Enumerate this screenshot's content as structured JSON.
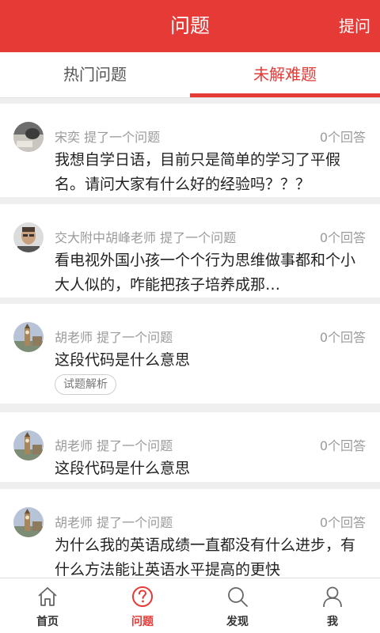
{
  "header": {
    "title": "问题",
    "ask_label": "提问"
  },
  "tabs": [
    {
      "label": "热门问题",
      "active": false
    },
    {
      "label": "未解难题",
      "active": true
    }
  ],
  "questions": [
    {
      "author": "宋奕",
      "action": "提了一个问题",
      "answers": "0个回答",
      "text": "我想自学日语，目前只是简单的学习了平假名。请问大家有什么好的经验吗？？？",
      "avatar": "desk-photo-avatar"
    },
    {
      "author": "交大附中胡峰老师",
      "action": "提了一个问题",
      "answers": "0个回答",
      "text": "看电视外国小孩一个个行为思维做事都和个小大人似的，咋能把孩子培养成那…",
      "avatar": "man-portrait-avatar"
    },
    {
      "author": "胡老师",
      "action": "提了一个问题",
      "answers": "0个回答",
      "text": "这段代码是什么意思",
      "tag": "试题解析",
      "avatar": "big-ben-avatar"
    },
    {
      "author": "胡老师",
      "action": "提了一个问题",
      "answers": "0个回答",
      "text": "这段代码是什么意思",
      "avatar": "big-ben-avatar"
    },
    {
      "author": "胡老师",
      "action": "提了一个问题",
      "answers": "0个回答",
      "text": "为什么我的英语成绩一直都没有什么进步，有什么方法能让英语水平提高的更快",
      "avatar": "big-ben-avatar"
    }
  ],
  "bottom_nav": [
    {
      "label": "首页",
      "icon": "home-icon",
      "active": false
    },
    {
      "label": "问题",
      "icon": "question-circle-icon",
      "active": true
    },
    {
      "label": "发现",
      "icon": "search-icon",
      "active": false
    },
    {
      "label": "我",
      "icon": "person-icon",
      "active": false
    }
  ],
  "colors": {
    "accent": "#e53a36",
    "meta": "#9a9a9a",
    "text": "#222222",
    "background": "#efefef"
  }
}
